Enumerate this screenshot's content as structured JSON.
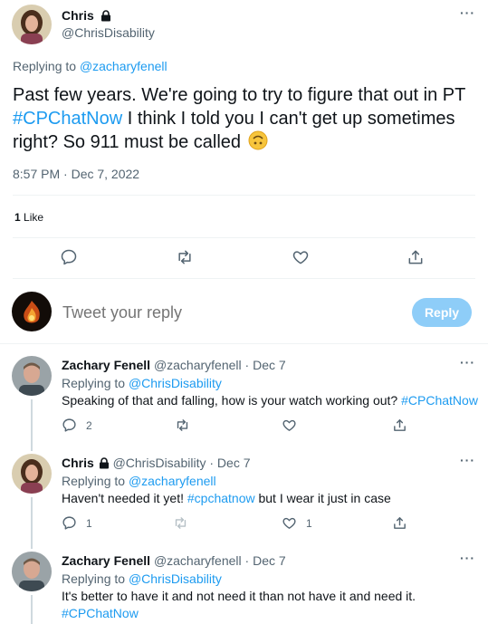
{
  "main_tweet": {
    "author_name": "Chris",
    "author_handle": "@ChrisDisability",
    "replying_to_label": "Replying to",
    "replying_to_handle": "@zacharyfenell",
    "text_before": "Past few years. We're going to try to figure that out in PT",
    "hashtag": "#CPChatNow",
    "text_after": " I think I told you I can't get up sometimes right? So 911 must be called",
    "emoji": "🙃",
    "timestamp": "8:57 PM · Dec 7, 2022",
    "likes_count": "1",
    "likes_label": "Like"
  },
  "compose": {
    "placeholder": "Tweet your reply",
    "reply_button": "Reply"
  },
  "replies": [
    {
      "name": "Zachary Fenell",
      "handle": "@zacharyfenell",
      "date": "· Dec 7",
      "replying_to_label": "Replying to",
      "replying_to_handle": "@ChrisDisability",
      "text_before": "Speaking of that and falling, how is your watch working out?",
      "hashtag": "#CPChatNow",
      "text_after": "",
      "reply_count": "2",
      "retweet_count": "",
      "like_count": ""
    },
    {
      "name": "Chris",
      "handle": "@ChrisDisability",
      "date": "· Dec 7",
      "replying_to_label": "Replying to",
      "replying_to_handle": "@zacharyfenell",
      "text_before": "Haven't needed it yet!",
      "hashtag": "#cpchatnow",
      "text_after": " but I wear it just in case",
      "reply_count": "1",
      "retweet_count": "",
      "like_count": "1"
    },
    {
      "name": "Zachary Fenell",
      "handle": "@zacharyfenell",
      "date": "· Dec 7",
      "replying_to_label": "Replying to",
      "replying_to_handle": "@ChrisDisability",
      "text_before": "It's better to have it and not need it than not have it and need it.",
      "hashtag": "#CPChatNow",
      "text_after": ""
    }
  ],
  "icons": {
    "more": "more-dots-icon",
    "reply": "reply-icon",
    "retweet": "retweet-icon",
    "like": "like-icon",
    "share": "share-icon",
    "lock": "lock-icon"
  },
  "colors": {
    "accent": "#1d9bf0",
    "reply_button_bg": "#8ecdf8",
    "text_secondary": "#536471",
    "divider": "#eff3f4"
  }
}
